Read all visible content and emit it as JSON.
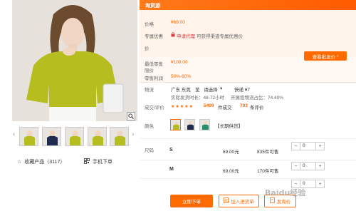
{
  "header": {
    "title": "淘货源"
  },
  "price": {
    "label": "价格",
    "value": "¥69.00"
  },
  "member": {
    "label": "专属优惠",
    "label2": "价",
    "link": "申请代理",
    "note": "可获得渠道专属优惠价"
  },
  "retail": {
    "label_line1": "最低零售",
    "label_line2": "限价",
    "value": "¥109.00",
    "profit_label": "零售利润",
    "profit_value": "50%-60%"
  },
  "batch_button": "查看批发价",
  "shipping": {
    "label": "物流",
    "from": "广东 东莞",
    "to_word": "至",
    "dest": "请选择",
    "arrow": "▾",
    "method": "快递 ¥7",
    "line2": "实际发货时长：48-72小时",
    "line3": "开展揽物流占比：74.40%"
  },
  "deals": {
    "label": "成交\\评价",
    "stars": "★★★★★",
    "deal_count": "5409",
    "deal_unit": "件成交",
    "review_count": "703",
    "review_unit": "条评价"
  },
  "color": {
    "label": "颜色",
    "tag": "【长期供货】"
  },
  "size": {
    "label": "尺码",
    "rows": [
      {
        "size": "S",
        "price": "69.00元",
        "stock": "835件可售",
        "qty": "0"
      },
      {
        "size": "M",
        "price": "69.00元",
        "stock": "170件可售",
        "qty": "0"
      },
      {
        "size": "",
        "price": "",
        "stock": "",
        "qty": "0"
      }
    ]
  },
  "actions": {
    "order": "立即下单",
    "store": "加入进货单",
    "inquiry": "发询价"
  },
  "left": {
    "favorite": "收藏产品（3117）",
    "mobile": "手机下单"
  },
  "watermark": "Baidu经验",
  "colors": {
    "accent": "#ff6a00",
    "shirt": "#b6bd1f",
    "navy": "#1f2a4f"
  }
}
